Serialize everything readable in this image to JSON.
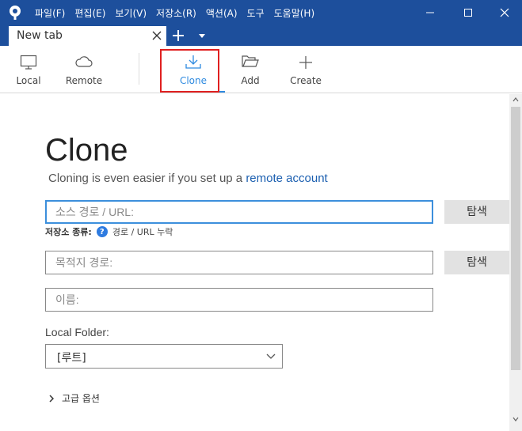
{
  "window": {
    "menu": [
      "파일(F)",
      "편집(E)",
      "보기(V)",
      "저장소(R)",
      "액션(A)",
      "도구",
      "도움말(H)"
    ]
  },
  "tabs": [
    {
      "label": "New tab"
    }
  ],
  "toolbar": {
    "local_label": "Local",
    "remote_label": "Remote",
    "clone_label": "Clone",
    "add_label": "Add",
    "create_label": "Create"
  },
  "clone": {
    "title": "Clone",
    "subtitle_prefix": "Cloning is even easier if you set up a ",
    "subtitle_link": "remote account",
    "source_placeholder": "소스 경로 / URL:",
    "browse_label": "탐색",
    "repo_type_label": "저장소 종류:",
    "repo_type_help": "?",
    "repo_type_value": "경로 / URL 누락",
    "dest_placeholder": "목적지 경로:",
    "browse2_label": "탐색",
    "name_placeholder": "이름:",
    "local_folder_label": "Local Folder:",
    "local_folder_value": "[루트]",
    "advanced_label": "고급 옵션"
  },
  "icons": {
    "app": "sourcetree-logo",
    "local": "monitor-icon",
    "remote": "cloud-icon",
    "clone": "download-icon",
    "add": "folder-open-icon",
    "create": "plus-icon"
  },
  "colors": {
    "titlebar": "#1d4f9c",
    "accent": "#2e8ae0",
    "link": "#1b5fb0",
    "highlight": "#e02020"
  }
}
